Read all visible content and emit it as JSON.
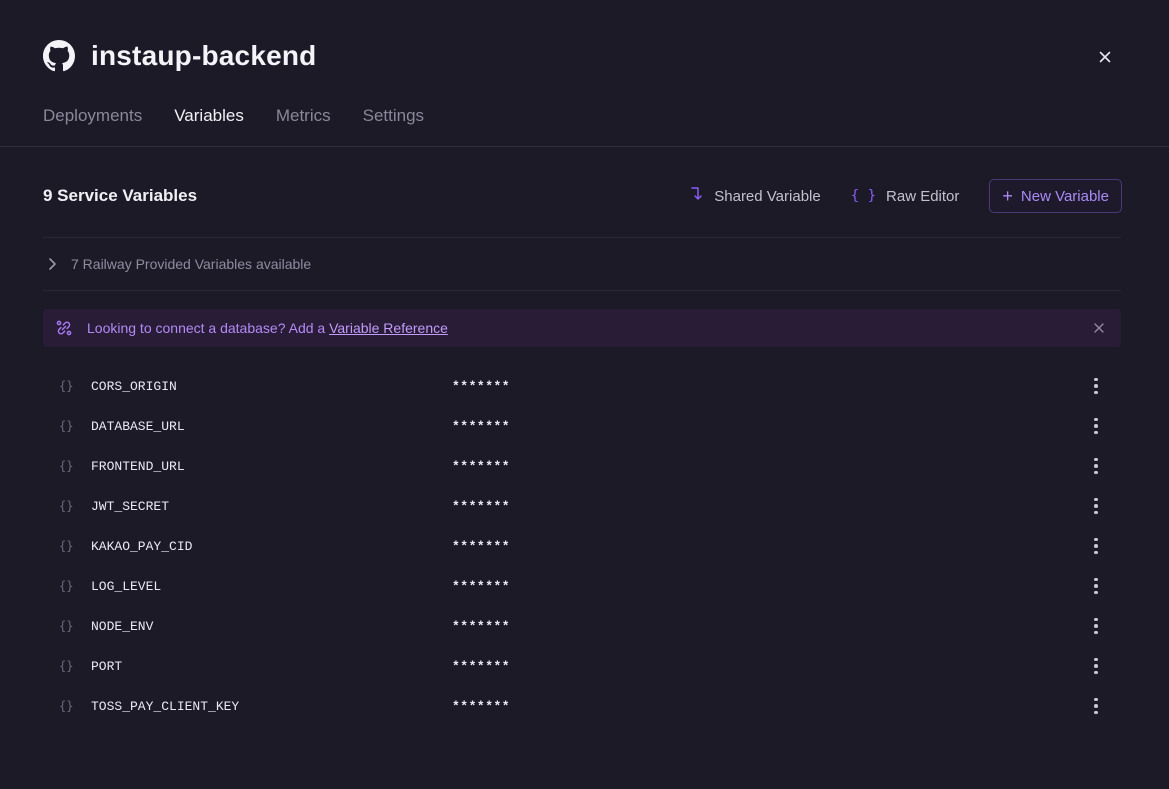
{
  "header": {
    "title": "instaup-backend",
    "icon": "github-icon"
  },
  "tabs": [
    {
      "label": "Deployments",
      "active": false
    },
    {
      "label": "Variables",
      "active": true
    },
    {
      "label": "Metrics",
      "active": false
    },
    {
      "label": "Settings",
      "active": false
    }
  ],
  "section": {
    "title": "9 Service Variables",
    "actions": {
      "shared_variable": "Shared Variable",
      "raw_editor": "Raw Editor",
      "new_variable": "New Variable"
    }
  },
  "provided": {
    "label": "7 Railway Provided Variables available"
  },
  "banner": {
    "text": "Looking to connect a database? Add a",
    "link": "Variable Reference"
  },
  "variables": [
    {
      "name": "CORS_ORIGIN",
      "value": "*******"
    },
    {
      "name": "DATABASE_URL",
      "value": "*******"
    },
    {
      "name": "FRONTEND_URL",
      "value": "*******"
    },
    {
      "name": "JWT_SECRET",
      "value": "*******"
    },
    {
      "name": "KAKAO_PAY_CID",
      "value": "*******"
    },
    {
      "name": "LOG_LEVEL",
      "value": "*******"
    },
    {
      "name": "NODE_ENV",
      "value": "*******"
    },
    {
      "name": "PORT",
      "value": "*******"
    },
    {
      "name": "TOSS_PAY_CLIENT_KEY",
      "value": "*******"
    }
  ],
  "colors": {
    "background": "#1c1a27",
    "accent": "#8b5cf6",
    "banner_bg": "#281c37"
  }
}
